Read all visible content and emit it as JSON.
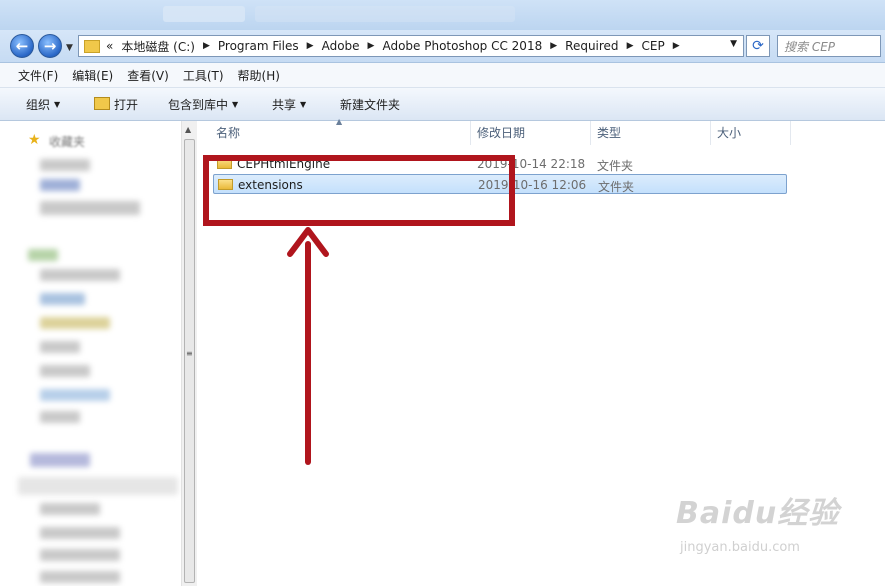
{
  "address": {
    "overflow_glyph": "«",
    "crumbs": [
      "本地磁盘 (C:)",
      "Program Files",
      "Adobe",
      "Adobe Photoshop CC 2018",
      "Required",
      "CEP"
    ],
    "separator": "▶",
    "dropdown_glyph": "▼",
    "refresh_glyph": "⟳",
    "back_glyph": "←",
    "forward_glyph": "→"
  },
  "search": {
    "placeholder": "搜索 CEP"
  },
  "menu": [
    "文件(F)",
    "编辑(E)",
    "查看(V)",
    "工具(T)",
    "帮助(H)"
  ],
  "commands": {
    "organize": "组织",
    "open": "打开",
    "include_library": "包含到库中",
    "share": "共享",
    "new_folder": "新建文件夹",
    "arrow_glyph": "▼"
  },
  "nav": {
    "favorites_label": "收藏夹"
  },
  "columns": {
    "name": "名称",
    "date": "修改日期",
    "type": "类型",
    "size": "大小"
  },
  "files": [
    {
      "name": "CEPHtmlEngine",
      "date": "2019-10-14 22:18",
      "type": "文件夹",
      "selected": false
    },
    {
      "name": "extensions",
      "date": "2019-10-16 12:06",
      "type": "文件夹",
      "selected": true
    }
  ],
  "watermark": {
    "main": "Baidu经验",
    "sub": "jingyan.baidu.com"
  },
  "colors": {
    "annotation": "#b0151d",
    "selection": "#c4e0fc"
  }
}
